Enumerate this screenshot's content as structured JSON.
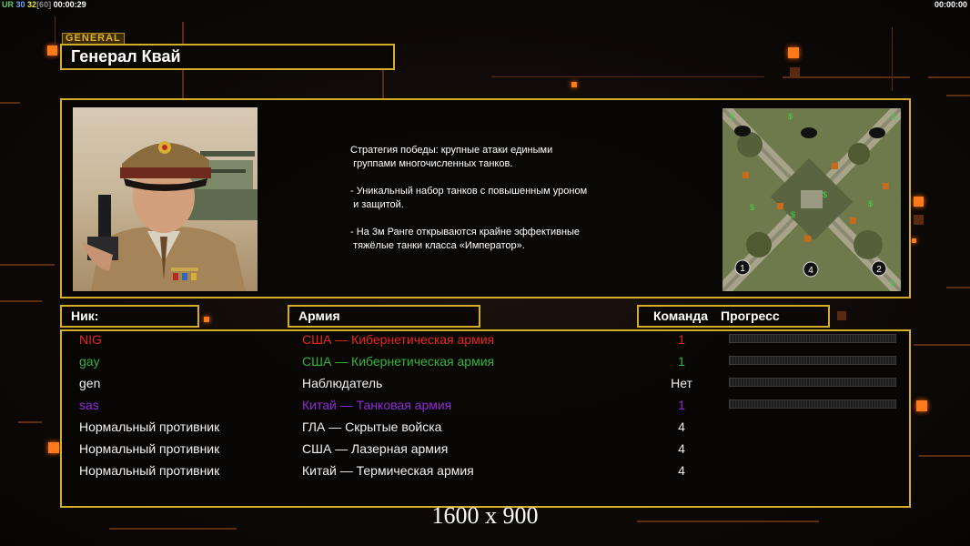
{
  "status_bar": {
    "left_parts": [
      "UR",
      "30",
      "32",
      "[60]",
      "00:00:29"
    ],
    "right_time": "00:00:00"
  },
  "general": {
    "tag": "GENERAL",
    "name": "Генерал Квай"
  },
  "description": "Стратегия победы: крупные атаки едиными\n группами многочисленных танков.\n\n- Уникальный набор танков с повышенным уроном\n и защитой.\n\n- На 3м Ранге открываются крайне эффективные\n тяжёлые танки класса «Император».",
  "map_markers": [
    "1",
    "4",
    "2"
  ],
  "headers": {
    "nick": "Ник:",
    "army": "Армия",
    "team": "Команда",
    "progress": "Прогресс"
  },
  "players": [
    {
      "nick": "NIG",
      "army": "США — Кибернетическая армия",
      "team": "1",
      "color": "#e8261f",
      "progress": true
    },
    {
      "nick": "gay",
      "army": "США — Кибернетическая армия",
      "team": "1",
      "color": "#34b43a",
      "progress": true
    },
    {
      "nick": "gen",
      "army": "Наблюдатель",
      "team": "Нет",
      "color": "#f2f2f2",
      "progress": true
    },
    {
      "nick": "sas",
      "army": "Китай — Танковая армия",
      "team": "1",
      "color": "#8f2bd6",
      "progress": true
    },
    {
      "nick": "Нормальный противник",
      "army": "ГЛА — Скрытые войска",
      "team": "4",
      "color": "#f2f2f2",
      "progress": false
    },
    {
      "nick": "Нормальный противник",
      "army": "США — Лазерная армия",
      "team": "4",
      "color": "#f2f2f2",
      "progress": false
    },
    {
      "nick": "Нормальный противник",
      "army": "Китай — Термическая армия",
      "team": "4",
      "color": "#f2f2f2",
      "progress": false
    }
  ],
  "resolution_text": "1600 x 900",
  "colors": {
    "accent_border": "#d6ad2b",
    "glow_orange": "#ff7a1a"
  }
}
